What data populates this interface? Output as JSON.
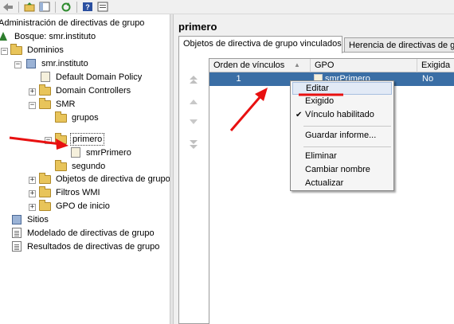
{
  "toolbar": {
    "buttons": [
      "back-arrow-icon",
      "folder-up-icon",
      "show-hide-tree-icon",
      "refresh-icon",
      "help-icon",
      "properties-icon"
    ]
  },
  "tree": {
    "root_label": "Administración de directivas de grupo",
    "forest_label": "Bosque: smr.instituto",
    "domains_label": "Dominios",
    "domain_label": "smr.instituto",
    "default_policy_label": "Default Domain Policy",
    "domain_controllers_label": "Domain Controllers",
    "smr_label": "SMR",
    "grupos_label": "grupos",
    "primero_label": "primero",
    "smrprimero_label": "smrPrimero",
    "segundo_label": "segundo",
    "gpo_objects_label": "Objetos de directiva de grupo",
    "wmi_filters_label": "Filtros WMI",
    "starter_gpo_label": "GPO de inicio",
    "sites_label": "Sitios",
    "modeling_label": "Modelado de directivas de grupo",
    "results_label": "Resultados de directivas de grupo"
  },
  "main": {
    "title": "primero",
    "tabs": [
      {
        "label": "Objetos de directiva de grupo vinculados"
      },
      {
        "label": "Herencia de directivas de gr"
      }
    ],
    "grid": {
      "columns": [
        "Orden de vínculos",
        "GPO",
        "Exigida"
      ],
      "rows": [
        {
          "order": "1",
          "gpo": "smrPrimero",
          "enforced": "No"
        }
      ]
    }
  },
  "context_menu": {
    "items": [
      {
        "label": "Editar",
        "highlighted": true
      },
      {
        "label": "Exigido"
      },
      {
        "label": "Vínculo habilitado",
        "checked": true
      },
      {
        "label": "Guardar informe..."
      },
      {
        "label": "Eliminar"
      },
      {
        "label": "Cambiar nombre"
      },
      {
        "label": "Actualizar"
      }
    ],
    "check_mark": "✔"
  },
  "colors": {
    "selection": "#3a6ea5",
    "annotation": "#e81010"
  }
}
